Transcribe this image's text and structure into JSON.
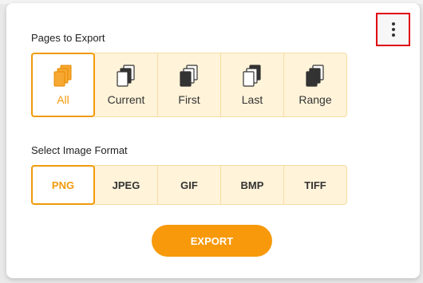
{
  "pages_section": {
    "title": "Pages to Export",
    "options": [
      {
        "label": "All",
        "icon": "all-pages-icon",
        "selected": true
      },
      {
        "label": "Current",
        "icon": "current-page-icon",
        "selected": false
      },
      {
        "label": "First",
        "icon": "first-page-icon",
        "selected": false
      },
      {
        "label": "Last",
        "icon": "last-page-icon",
        "selected": false
      },
      {
        "label": "Range",
        "icon": "range-pages-icon",
        "selected": false
      }
    ]
  },
  "format_section": {
    "title": "Select Image Format",
    "options": [
      {
        "label": "PNG",
        "selected": true
      },
      {
        "label": "JPEG",
        "selected": false
      },
      {
        "label": "GIF",
        "selected": false
      },
      {
        "label": "BMP",
        "selected": false
      },
      {
        "label": "TIFF",
        "selected": false
      }
    ]
  },
  "export_button": {
    "label": "EXPORT"
  },
  "menu_button": {
    "icon": "kebab-menu-icon"
  },
  "colors": {
    "accent": "#f19a0b",
    "option_bg": "#fff3d9",
    "highlight_border": "#e0000e"
  }
}
